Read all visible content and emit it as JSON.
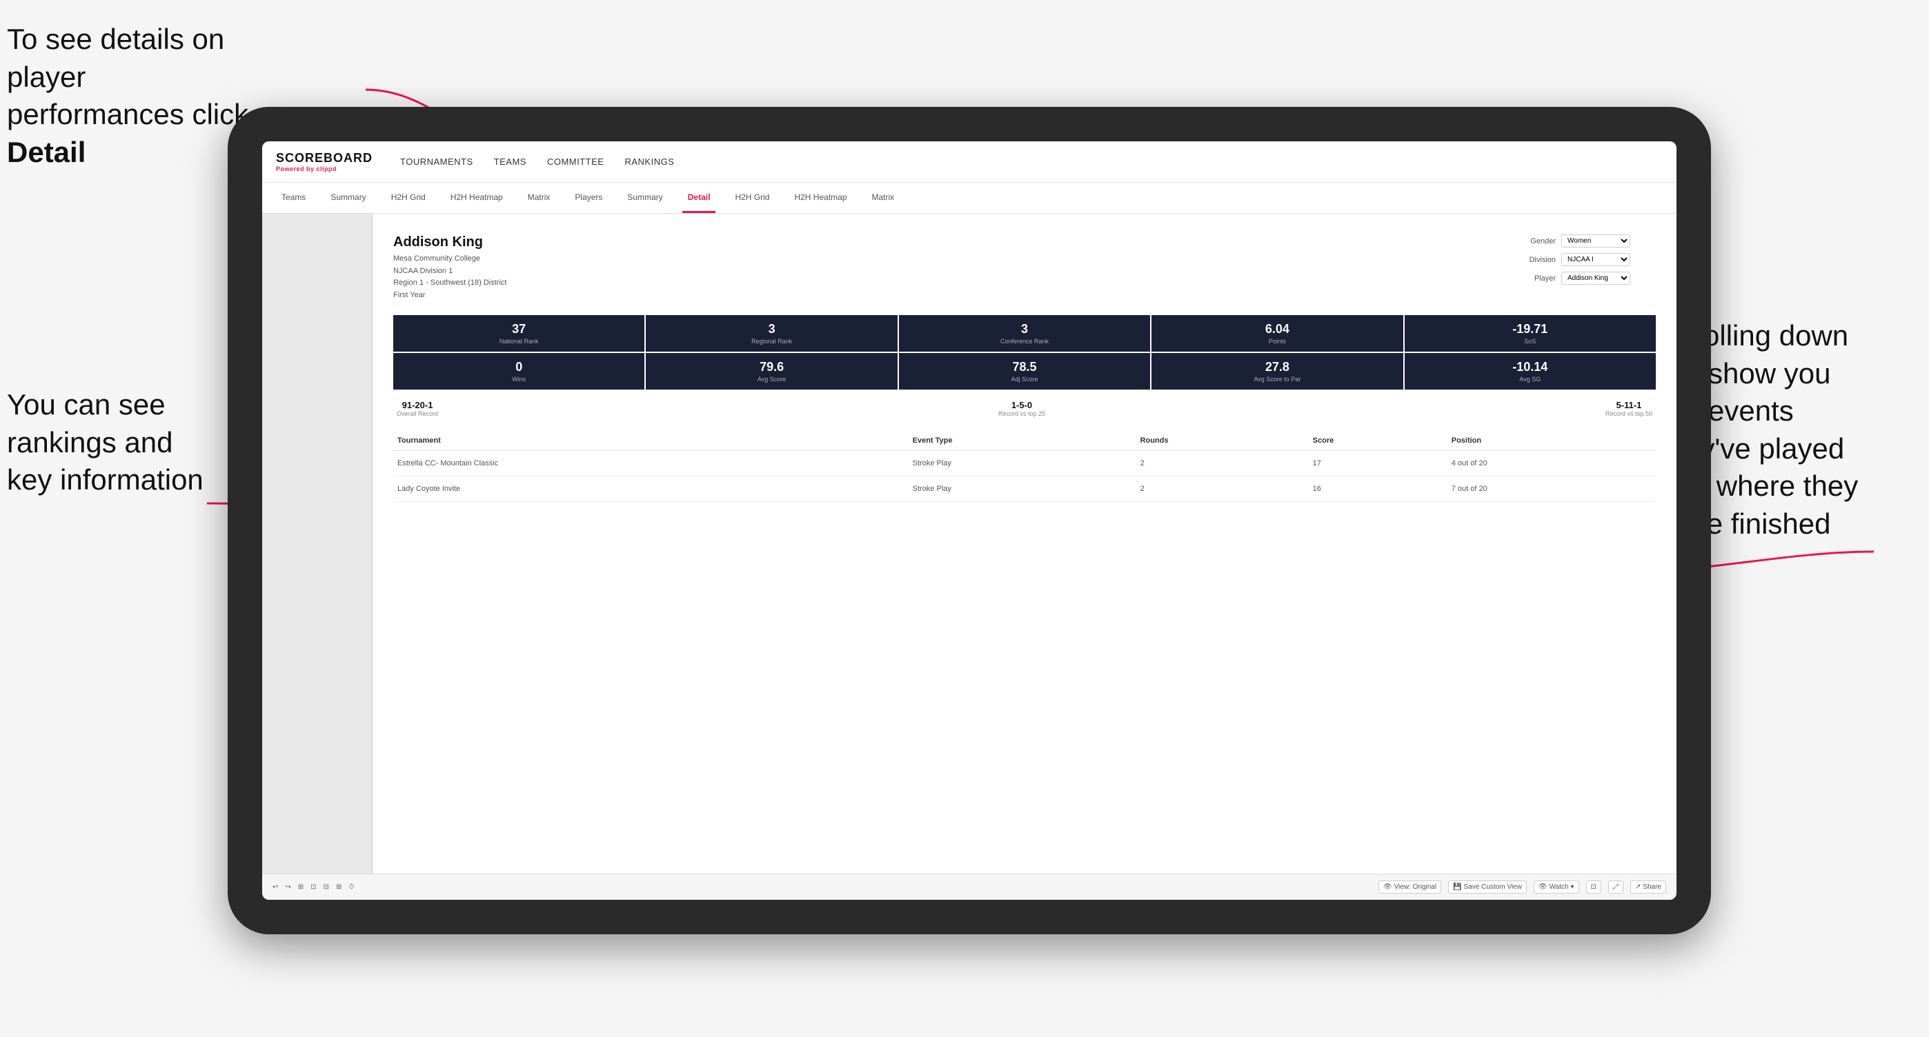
{
  "annotations": {
    "top_left": "To see details on player performances click ",
    "top_left_bold": "Detail",
    "bottom_left_line1": "You can see",
    "bottom_left_line2": "rankings and",
    "bottom_left_line3": "key information",
    "right_line1": "Scrolling down",
    "right_line2": "will show you",
    "right_line3": "the events",
    "right_line4": "they've played",
    "right_line5": "and where they",
    "right_line6": "have finished"
  },
  "nav": {
    "logo": "SCOREBOARD",
    "logo_sub_prefix": "Powered by ",
    "logo_sub_brand": "clippd",
    "main_items": [
      "TOURNAMENTS",
      "TEAMS",
      "COMMITTEE",
      "RANKINGS"
    ],
    "sub_items": [
      "Teams",
      "Summary",
      "H2H Grid",
      "H2H Heatmap",
      "Matrix",
      "Players",
      "Summary",
      "Detail",
      "H2H Grid",
      "H2H Heatmap",
      "Matrix"
    ],
    "active_sub": "Detail"
  },
  "player": {
    "name": "Addison King",
    "school": "Mesa Community College",
    "division": "NJCAA Division 1",
    "region": "Region 1 - Southwest (18) District",
    "year": "First Year",
    "gender_label": "Gender",
    "gender_value": "Women",
    "division_label": "Division",
    "division_value": "NJCAA I",
    "player_label": "Player",
    "player_value": "Addison King"
  },
  "stats_row1": [
    {
      "value": "37",
      "label": "National Rank"
    },
    {
      "value": "3",
      "label": "Regional Rank"
    },
    {
      "value": "3",
      "label": "Conference Rank"
    },
    {
      "value": "6.04",
      "label": "Points"
    },
    {
      "value": "-19.71",
      "label": "SoS"
    }
  ],
  "stats_row2": [
    {
      "value": "0",
      "label": "Wins"
    },
    {
      "value": "79.6",
      "label": "Avg Score"
    },
    {
      "value": "78.5",
      "label": "Adj Score"
    },
    {
      "value": "27.8",
      "label": "Avg Score to Par"
    },
    {
      "value": "-10.14",
      "label": "Avg SG"
    }
  ],
  "records": [
    {
      "value": "91-20-1",
      "label": "Overall Record"
    },
    {
      "value": "1-5-0",
      "label": "Record vs top 25"
    },
    {
      "value": "5-11-1",
      "label": "Record vs top 50"
    }
  ],
  "table": {
    "headers": [
      "Tournament",
      "Event Type",
      "Rounds",
      "Score",
      "Position"
    ],
    "rows": [
      {
        "tournament": "Estrella CC- Mountain Classic",
        "event_type": "Stroke Play",
        "rounds": "2",
        "score": "17",
        "position": "4 out of 20"
      },
      {
        "tournament": "Lady Coyote Invite",
        "event_type": "Stroke Play",
        "rounds": "2",
        "score": "16",
        "position": "7 out of 20"
      }
    ]
  },
  "toolbar": {
    "view_original": "View: Original",
    "save_custom": "Save Custom View",
    "watch": "Watch",
    "share": "Share"
  }
}
